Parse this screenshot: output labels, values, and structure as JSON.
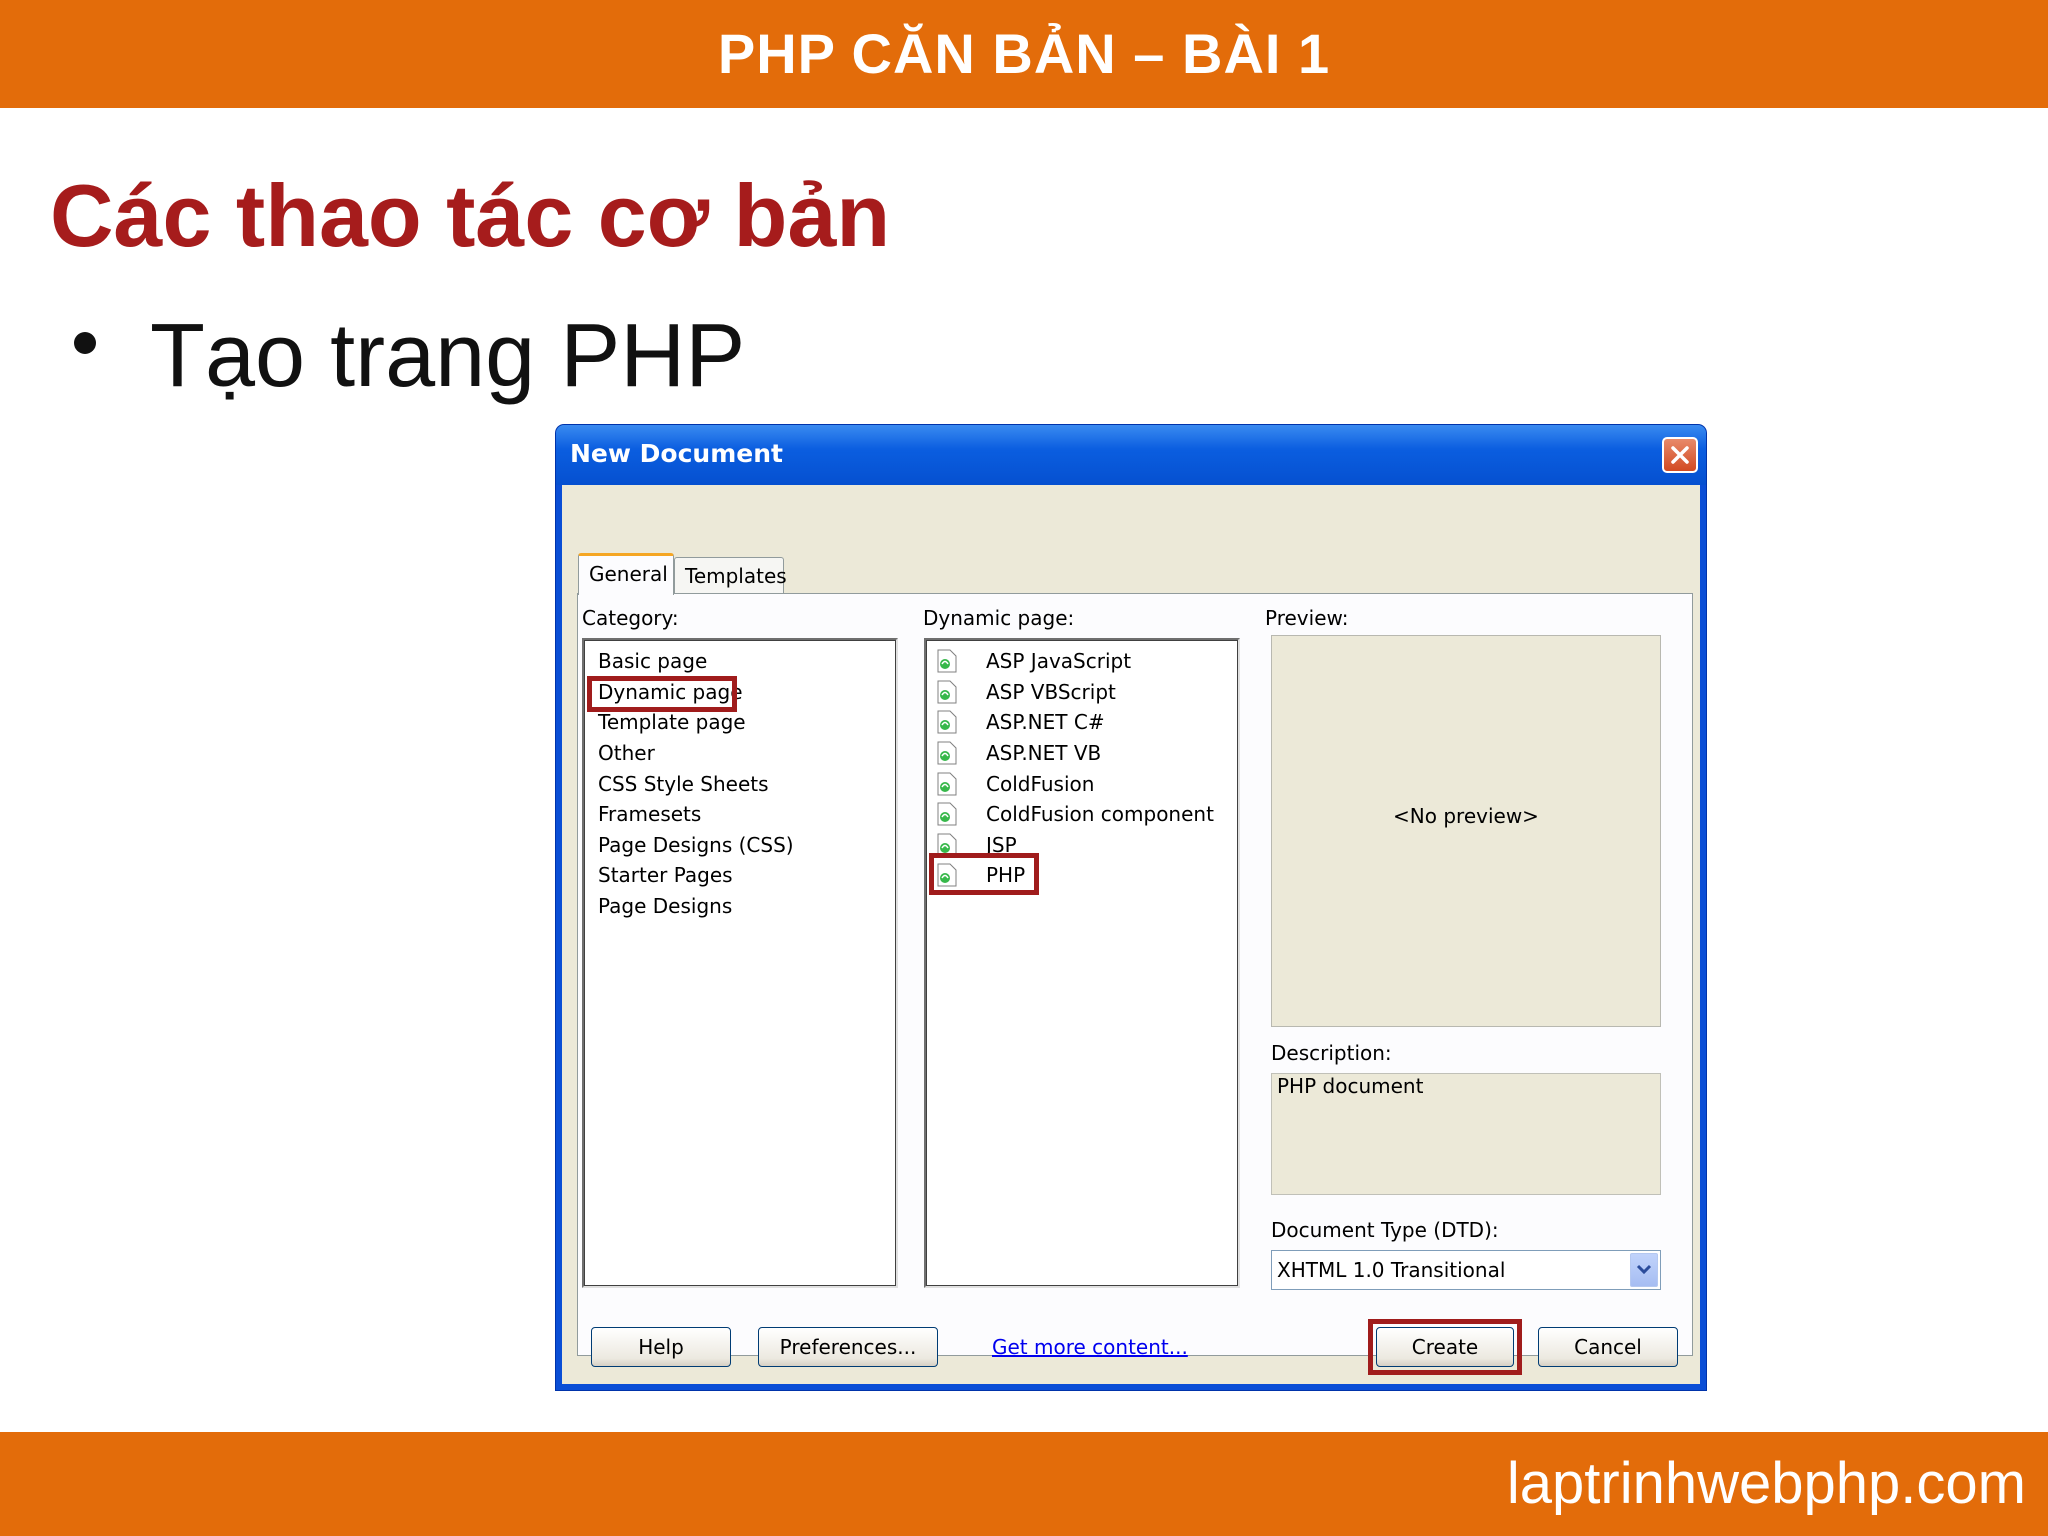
{
  "slide": {
    "header": "PHP CĂN BẢN – BÀI 1",
    "heading": "Các thao tác cơ bản",
    "bullet": "Tạo trang PHP",
    "footer_url": "laptrinhwebphp.com",
    "colors": {
      "bar": "#e36c0a",
      "heading": "#a61c1c",
      "highlight": "#a01c1c"
    }
  },
  "dialog": {
    "title": "New Document",
    "tabs": [
      {
        "label": "General",
        "active": true
      },
      {
        "label": "Templates",
        "active": false
      }
    ],
    "category_label": "Category:",
    "categories": [
      "Basic page",
      "Dynamic page",
      "Template page",
      "Other",
      "CSS Style Sheets",
      "Framesets",
      "Page Designs (CSS)",
      "Starter Pages",
      "Page Designs"
    ],
    "selected_category": "Dynamic page",
    "dynamic_label": "Dynamic page:",
    "dynamic_items": [
      {
        "label": "ASP JavaScript",
        "icon": "document-icon"
      },
      {
        "label": "ASP VBScript",
        "icon": "document-icon"
      },
      {
        "label": "ASP.NET C#",
        "icon": "document-icon"
      },
      {
        "label": "ASP.NET VB",
        "icon": "document-icon"
      },
      {
        "label": "ColdFusion",
        "icon": "document-icon"
      },
      {
        "label": "ColdFusion component",
        "icon": "document-icon"
      },
      {
        "label": "JSP",
        "icon": "document-icon"
      },
      {
        "label": "PHP",
        "icon": "document-icon"
      }
    ],
    "selected_dynamic": "PHP",
    "preview_label": "Preview:",
    "preview_text": "<No preview>",
    "description_label": "Description:",
    "description_text": "PHP document",
    "doctype_label": "Document Type (DTD):",
    "doctype_value": "XHTML 1.0 Transitional",
    "buttons": {
      "help": "Help",
      "preferences": "Preferences...",
      "get_more": "Get more content...",
      "create": "Create",
      "cancel": "Cancel"
    }
  }
}
